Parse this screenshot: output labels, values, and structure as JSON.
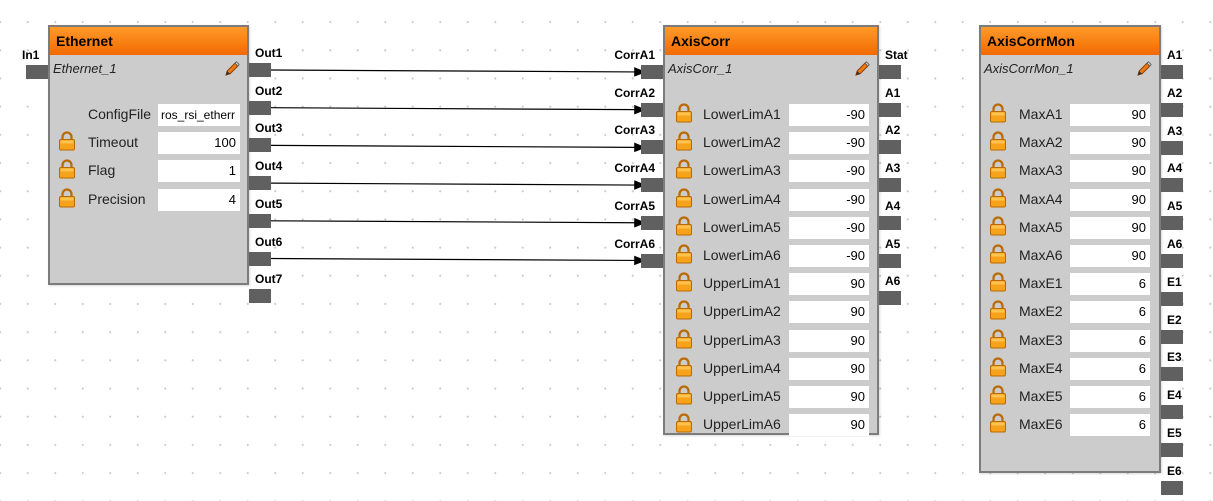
{
  "blocks": {
    "ethernet": {
      "title": "Ethernet",
      "name": "Ethernet_1",
      "params": [
        {
          "label": "ConfigFile",
          "value": "ros_rsi_etherr",
          "locked": false
        },
        {
          "label": "Timeout",
          "value": "100",
          "locked": true
        },
        {
          "label": "Flag",
          "value": "1",
          "locked": true
        },
        {
          "label": "Precision",
          "value": "4",
          "locked": true
        }
      ],
      "inputs": [
        "In1"
      ],
      "outputs": [
        "Out1",
        "Out2",
        "Out3",
        "Out4",
        "Out5",
        "Out6",
        "Out7"
      ]
    },
    "axiscorr": {
      "title": "AxisCorr",
      "name": "AxisCorr_1",
      "params": [
        {
          "label": "LowerLimA1",
          "value": "-90",
          "locked": true
        },
        {
          "label": "LowerLimA2",
          "value": "-90",
          "locked": true
        },
        {
          "label": "LowerLimA3",
          "value": "-90",
          "locked": true
        },
        {
          "label": "LowerLimA4",
          "value": "-90",
          "locked": true
        },
        {
          "label": "LowerLimA5",
          "value": "-90",
          "locked": true
        },
        {
          "label": "LowerLimA6",
          "value": "-90",
          "locked": true
        },
        {
          "label": "UpperLimA1",
          "value": "90",
          "locked": true
        },
        {
          "label": "UpperLimA2",
          "value": "90",
          "locked": true
        },
        {
          "label": "UpperLimA3",
          "value": "90",
          "locked": true
        },
        {
          "label": "UpperLimA4",
          "value": "90",
          "locked": true
        },
        {
          "label": "UpperLimA5",
          "value": "90",
          "locked": true
        },
        {
          "label": "UpperLimA6",
          "value": "90",
          "locked": true
        }
      ],
      "inputs": [
        "CorrA1",
        "CorrA2",
        "CorrA3",
        "CorrA4",
        "CorrA5",
        "CorrA6"
      ],
      "outputs": [
        "Stat",
        "A1",
        "A2",
        "A3",
        "A4",
        "A5",
        "A6"
      ]
    },
    "axiscorrmon": {
      "title": "AxisCorrMon",
      "name": "AxisCorrMon_1",
      "params": [
        {
          "label": "MaxA1",
          "value": "90",
          "locked": true
        },
        {
          "label": "MaxA2",
          "value": "90",
          "locked": true
        },
        {
          "label": "MaxA3",
          "value": "90",
          "locked": true
        },
        {
          "label": "MaxA4",
          "value": "90",
          "locked": true
        },
        {
          "label": "MaxA5",
          "value": "90",
          "locked": true
        },
        {
          "label": "MaxA6",
          "value": "90",
          "locked": true
        },
        {
          "label": "MaxE1",
          "value": "6",
          "locked": true
        },
        {
          "label": "MaxE2",
          "value": "6",
          "locked": true
        },
        {
          "label": "MaxE3",
          "value": "6",
          "locked": true
        },
        {
          "label": "MaxE4",
          "value": "6",
          "locked": true
        },
        {
          "label": "MaxE5",
          "value": "6",
          "locked": true
        },
        {
          "label": "MaxE6",
          "value": "6",
          "locked": true
        }
      ],
      "inputs": [],
      "outputs": [
        "A1",
        "A2",
        "A3",
        "A4",
        "A5",
        "A6",
        "E1",
        "E2",
        "E3",
        "E4",
        "E5",
        "E6"
      ]
    }
  },
  "connections": [
    {
      "from": "Out1",
      "to": "CorrA1"
    },
    {
      "from": "Out2",
      "to": "CorrA2"
    },
    {
      "from": "Out3",
      "to": "CorrA3"
    },
    {
      "from": "Out4",
      "to": "CorrA4"
    },
    {
      "from": "Out5",
      "to": "CorrA5"
    },
    {
      "from": "Out6",
      "to": "CorrA6"
    }
  ],
  "colors": {
    "header": "#f47a0a",
    "block_body": "#cccccc",
    "port": "#606060",
    "wire": "#000000"
  },
  "icons": {
    "edit": "pencil-icon",
    "lock": "lock-icon"
  }
}
